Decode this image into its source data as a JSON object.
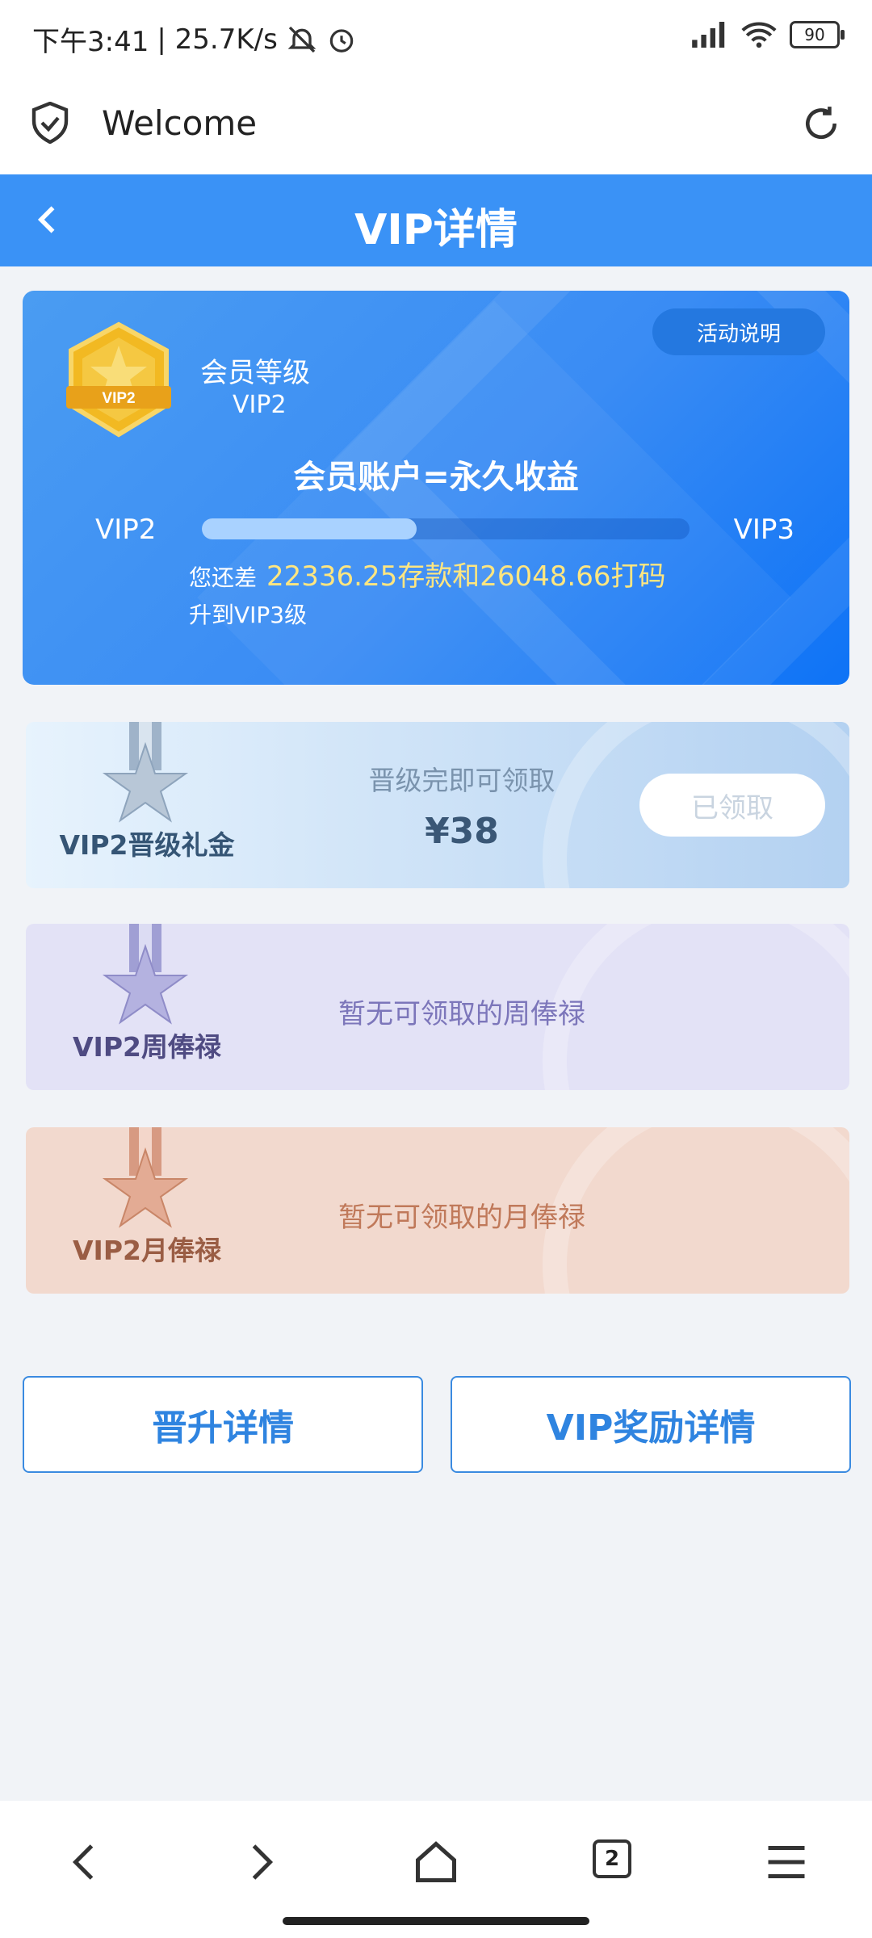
{
  "status_bar": {
    "time": "下午3:41",
    "speed": "| 25.7K/s",
    "battery": "90"
  },
  "browser": {
    "page_title": "Welcome"
  },
  "header": {
    "title": "VIP详情"
  },
  "vip_card": {
    "level_label": "会员等级",
    "level_value": "VIP2",
    "badge_text": "VIP2",
    "activity_button": "活动说明",
    "slogan": "会员账户=永久收益",
    "progress": {
      "from": "VIP2",
      "to": "VIP3",
      "fraction": 0.44
    },
    "remaining_prefix": "您还差",
    "remaining_highlight": "22336.25存款和26048.66打码",
    "remaining_suffix": "升到VIP3级"
  },
  "rewards": [
    {
      "title": "VIP2晋级礼金",
      "subtitle": "晋级完即可领取",
      "amount": "¥38",
      "button": "已领取",
      "medal_color": "#9fb3c9"
    },
    {
      "title": "VIP2周俸禄",
      "message": "暂无可领取的周俸禄",
      "medal_color": "#a09fd4"
    },
    {
      "title": "VIP2月俸禄",
      "message": "暂无可领取的月俸禄",
      "medal_color": "#d79a82"
    }
  ],
  "buttons": {
    "promotion_details": "晋升详情",
    "reward_details": "VIP奖励详情"
  },
  "bottom_nav": {
    "tab_count": "2"
  },
  "colors": {
    "header": "#3a92f6",
    "accent": "#2f84e0",
    "highlight": "#ffe680"
  }
}
